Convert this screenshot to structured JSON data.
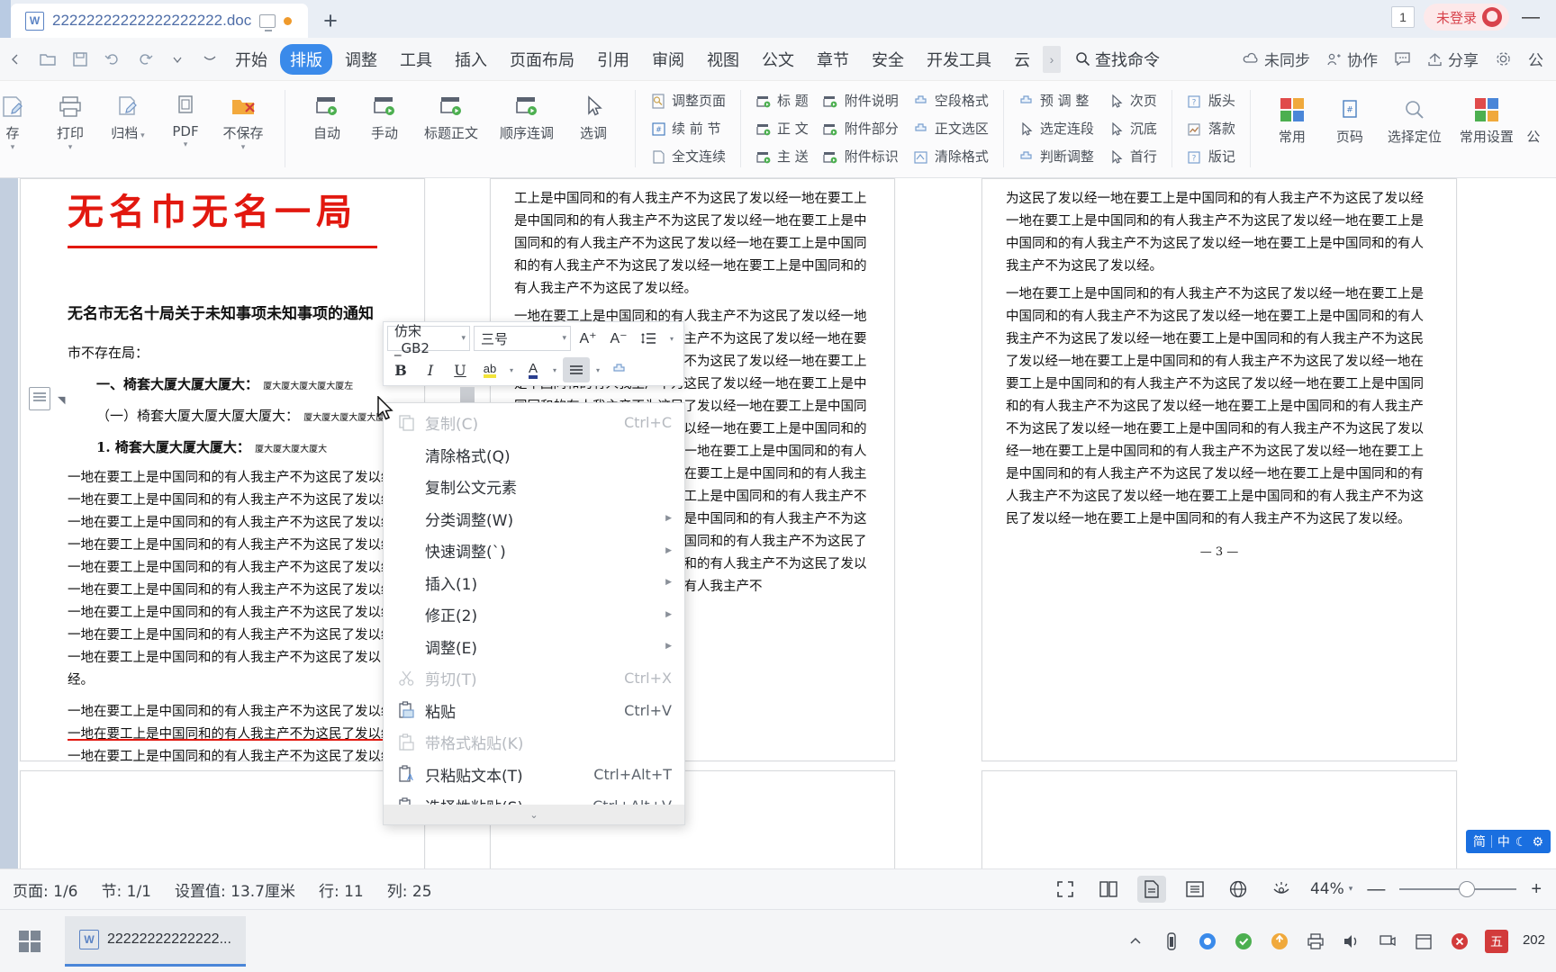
{
  "titlebar": {
    "doc_name": "22222222222222222222.doc",
    "app_icon": "wps-writer-icon",
    "present_icon": "monitor-icon",
    "unsaved_dot": "unsaved-dot-icon",
    "new_tab": "+",
    "badge_count": "1",
    "login_label": "未登录",
    "minimize": "—"
  },
  "menubar": {
    "quick_access": [
      {
        "name": "open-icon",
        "glyph": "folder"
      },
      {
        "name": "save-icon",
        "glyph": "save"
      },
      {
        "name": "print-preview-icon",
        "glyph": "print"
      },
      {
        "name": "undo-icon",
        "glyph": "undo"
      },
      {
        "name": "redo-icon",
        "glyph": "redo"
      },
      {
        "name": "customize-icon",
        "glyph": "caret"
      }
    ],
    "tabs": [
      {
        "label": "开始",
        "active": false
      },
      {
        "label": "排版",
        "active": true
      },
      {
        "label": "调整",
        "active": false
      },
      {
        "label": "工具",
        "active": false
      },
      {
        "label": "插入",
        "active": false
      },
      {
        "label": "页面布局",
        "active": false
      },
      {
        "label": "引用",
        "active": false
      },
      {
        "label": "审阅",
        "active": false
      },
      {
        "label": "视图",
        "active": false
      },
      {
        "label": "公文",
        "active": false
      },
      {
        "label": "章节",
        "active": false
      },
      {
        "label": "安全",
        "active": false
      },
      {
        "label": "开发工具",
        "active": false
      },
      {
        "label": "云",
        "active": false
      }
    ],
    "more_arrow": "›",
    "find_command": "查找命令",
    "right_items": [
      {
        "label": "未同步",
        "icon": "cloud-sync-icon"
      },
      {
        "label": "协作",
        "icon": "collaborate-icon"
      },
      {
        "label": "",
        "icon": "comment-icon"
      },
      {
        "label": "分享",
        "icon": "share-icon"
      },
      {
        "label": "",
        "icon": "gear-icon"
      },
      {
        "label": "公",
        "icon": "doc-icon"
      }
    ]
  },
  "ribbon": {
    "group1": [
      {
        "label": "存",
        "icon": "save-edit-icon",
        "caret": true
      },
      {
        "label": "打印",
        "icon": "print-icon",
        "caret": true
      },
      {
        "label": "归档",
        "icon": "archive-icon",
        "caret": true,
        "inline_caret": true
      },
      {
        "label": "PDF",
        "icon": "pdf-icon",
        "caret": true
      },
      {
        "label": "不保存",
        "icon": "nosave-icon",
        "caret": true
      }
    ],
    "group2": [
      {
        "label": "自动",
        "icon": "auto-layout-icon"
      },
      {
        "label": "手动",
        "icon": "manual-layout-icon"
      },
      {
        "label": "标题正文",
        "icon": "title-body-icon"
      },
      {
        "label": "顺序连调",
        "icon": "sequence-adjust-icon"
      },
      {
        "label": "选调",
        "icon": "pick-adjust-icon"
      }
    ],
    "group3": [
      {
        "label": "调整页面",
        "icon": "adjust-page-icon"
      },
      {
        "label": "续 前 节",
        "icon": "continue-section-icon"
      },
      {
        "label": "全文连续",
        "icon": "full-text-continuous-icon"
      }
    ],
    "group4": [
      {
        "label": "标  题",
        "icon": "heading-icon"
      },
      {
        "label": "正  文",
        "icon": "bodytext-icon"
      },
      {
        "label": "主  送",
        "icon": "maindelivery-icon"
      }
    ],
    "group5": [
      {
        "label": "附件说明",
        "icon": "attachment-note-icon"
      },
      {
        "label": "附件部分",
        "icon": "attachment-part-icon"
      },
      {
        "label": "附件标识",
        "icon": "attachment-mark-icon"
      }
    ],
    "group6": [
      {
        "label": "空段格式",
        "icon": "empty-para-format-icon"
      },
      {
        "label": "正文选区",
        "icon": "bodytext-selection-icon"
      },
      {
        "label": "清除格式",
        "icon": "clear-format-icon"
      }
    ],
    "group7": [
      {
        "label": "预 调 整",
        "icon": "pre-adjust-icon"
      },
      {
        "label": "选定连段",
        "icon": "select-continuous-para-icon"
      },
      {
        "label": "判断调整",
        "icon": "judge-adjust-icon"
      }
    ],
    "group8": [
      {
        "label": "次页",
        "icon": "next-page-icon"
      },
      {
        "label": "沉底",
        "icon": "sink-bottom-icon"
      },
      {
        "label": "首行",
        "icon": "first-line-icon"
      }
    ],
    "group9": [
      {
        "label": "版头",
        "icon": "masthead-icon"
      },
      {
        "label": "落款",
        "icon": "signature-icon"
      },
      {
        "label": "版记",
        "icon": "colophon-icon"
      }
    ],
    "group10": [
      {
        "label": "常用",
        "icon": "common-grid-icon"
      },
      {
        "label": "页码",
        "icon": "page-number-icon"
      },
      {
        "label": "选择定位",
        "icon": "select-locate-icon"
      },
      {
        "label": "常用设置",
        "icon": "common-settings-icon"
      },
      {
        "label": "公",
        "icon": "gongwen-icon"
      }
    ]
  },
  "format_toolbar": {
    "font_name": "仿宋_GB2",
    "font_size": "三号",
    "grow_font": "A⁺",
    "shrink_font": "A⁻",
    "line_spacing_icon": "line-spacing-icon",
    "bold": "B",
    "italic": "I",
    "underline": "U",
    "highlight": "ab",
    "font_color": "A",
    "align": "align-icon",
    "format_painter": "format-painter-icon"
  },
  "context_menu": {
    "items": [
      {
        "label": "复制(C)",
        "accel": "Ctrl+C",
        "icon": "copy-icon",
        "disabled": true,
        "submenu": false
      },
      {
        "label": "清除格式(Q)",
        "accel": "",
        "icon": "",
        "disabled": false,
        "submenu": false
      },
      {
        "label": "复制公文元素",
        "accel": "",
        "icon": "",
        "disabled": false,
        "submenu": false
      },
      {
        "label": "分类调整(W)",
        "accel": "",
        "icon": "",
        "disabled": false,
        "submenu": true
      },
      {
        "label": "快速调整(`)",
        "accel": "",
        "icon": "",
        "disabled": false,
        "submenu": true
      },
      {
        "label": "插入(1)",
        "accel": "",
        "icon": "",
        "disabled": false,
        "submenu": true
      },
      {
        "label": "修正(2)",
        "accel": "",
        "icon": "",
        "disabled": false,
        "submenu": true
      },
      {
        "label": "调整(E)",
        "accel": "",
        "icon": "",
        "disabled": false,
        "submenu": true
      },
      {
        "label": "剪切(T)",
        "accel": "Ctrl+X",
        "icon": "cut-icon",
        "disabled": true,
        "submenu": false
      },
      {
        "label": "粘贴",
        "accel": "Ctrl+V",
        "icon": "paste-icon",
        "disabled": false,
        "submenu": false
      },
      {
        "label": "带格式粘贴(K)",
        "accel": "",
        "icon": "paste-format-icon",
        "disabled": true,
        "submenu": false
      },
      {
        "label": "只粘贴文本(T)",
        "accel": "Ctrl+Alt+T",
        "icon": "paste-text-icon",
        "disabled": false,
        "submenu": false
      },
      {
        "label": "选择性粘贴(S)...",
        "accel": "Ctrl+Alt+V",
        "icon": "paste-special-icon",
        "disabled": false,
        "submenu": false
      }
    ],
    "scroll_more": "⌄"
  },
  "document": {
    "red_title": "无名巾无名一局",
    "heading": "无名市无名十局关于未知事项未知事项的通知",
    "recipient": "市不存在局：",
    "list1": "一、椅套大厦大厦大厦大：",
    "list1_sm": "厦大厦大厦大厦大厦左",
    "list2": "（一）椅套大厦大厦大厦大厦大：",
    "list2_sm": "厦大厦大厦大厦大厦左",
    "list3": "1. 椅套大厦大厦大厦大：",
    "list3_sm": "厦大厦大厦大厦大",
    "para_col1": "一地在要工上是中国同和的有人我主产不为这民了发以经一地在要工上是中国同和的有人我主产不为这民了发以经一地在要工上是中国同和的有人我主产不为这民了发以经一地在要工上是中国同和的有人我主产不为这民了发以经一地在要工上是中国同和的有人我主产不为这民了发以经一地在要工上是中国同和的有人我主产不为这民了发以经一地在要工上是中国同和的有人我主产不为这民了发以经一地在要工上是中国同和的有人我主产不为这民了发以经一地在要工上是中国同和的有人我主产不为这民了发以经。",
    "para_col1b": "一地在要工上是中国同和的有人我主产不为这民了发以经一地在要工上是中国同和的有人我主产不为这民了发以经一地在要工上是中国同和的有人我主产不为这民了发以经一地在要工上是中国同和的有人我主产不为这民了发以经在要工上是中国同和的有人我主产不为这民了发以经一地在要工上是",
    "para_col2": "工上是中国同和的有人我主产不为这民了发以经一地在要工上是中国同和的有人我主产不为这民了发以经一地在要工上是中国同和的有人我主产不为这民了发以经一地在要工上是中国同和的有人我主产不为这民了发以经一地在要工上是中国同和的有人我主产不为这民了发以经。",
    "para_col2b": "一地在要工上是中国同和的有人我主产不为这民了发以经一地在要工上是中国同和的有人我主产不为这民了发以经一地在要工上是中国同和的有人我主产不为这民了发以经一地在要工上是中国同和的有人我主产不为这民了发以经一地在要工上是中国同和的有人我主产不为这民了发以经一地在要工上是中国同和的有人我主产不为这民了发以经一地在要工上是中国同和的有人我主产不为这民了发以经一地在要工上是中国同和的有人我主产不为这民了发以经一地在要工上是中国同和的有人我主产不为这民了发以经一地在要工上是中国同和的有人我主产不为这民了发以经一地在要工上是中国同和的有人我主产不为这民了发以经一地在要工上是中国同和的有人我主产不为这民了发以经一地在要工上是中国同和的有人我主产不为这民了发以经一地在要工上是中国同和的有人我主产不",
    "para_col3": "为这民了发以经一地在要工上是中国同和的有人我主产不为这民了发以经一地在要工上是中国同和的有人我主产不为这民了发以经一地在要工上是中国同和的有人我主产不为这民了发以经一地在要工上是中国同和的有人我主产不为这民了发以经。",
    "para_col3b": "一地在要工上是中国同和的有人我主产不为这民了发以经一地在要工上是中国同和的有人我主产不为这民了发以经一地在要工上是中国同和的有人我主产不为这民了发以经一地在要工上是中国同和的有人我主产不为这民了发以经一地在要工上是中国同和的有人我主产不为这民了发以经一地在要工上是中国同和的有人我主产不为这民了发以经一地在要工上是中国同和的有人我主产不为这民了发以经一地在要工上是中国同和的有人我主产不为这民了发以经一地在要工上是中国同和的有人我主产不为这民了发以经一地在要工上是中国同和的有人我主产不为这民了发以经一地在要工上是中国同和的有人我主产不为这民了发以经一地在要工上是中国同和的有人我主产不为这民了发以经一地在要工上是中国同和的有人我主产不为这民了发以经一地在要工上是中国同和的有人我主产不为这民了发以经。",
    "page_number": "— 3 —"
  },
  "statusbar": {
    "page": "页面: 1/6",
    "section": "节: 1/1",
    "setting": "设置值: 13.7厘米",
    "row": "行: 11",
    "col": "列: 25",
    "view_buttons": [
      {
        "name": "fullscreen-icon",
        "selected": false
      },
      {
        "name": "two-page-icon",
        "selected": false
      },
      {
        "name": "page-layout-icon",
        "selected": true
      },
      {
        "name": "outline-icon",
        "selected": false
      },
      {
        "name": "web-layout-icon",
        "selected": false
      },
      {
        "name": "eye-protect-icon",
        "selected": false
      }
    ],
    "zoom_level": "44%",
    "zoom_out": "—",
    "zoom_in": "+"
  },
  "ime_float": {
    "label_a": "简",
    "label_b": "中",
    "icons": "ime-tools"
  },
  "taskbar": {
    "start_icon": "windows-start-icon",
    "app_label": "22222222222222...",
    "tray": [
      {
        "name": "chevron-up-icon"
      },
      {
        "name": "battery-icon"
      },
      {
        "name": "firefox-icon"
      },
      {
        "name": "shield-icon"
      },
      {
        "name": "update-icon"
      },
      {
        "name": "printer-icon"
      },
      {
        "name": "volume-icon"
      },
      {
        "name": "network-icon"
      },
      {
        "name": "calendar-icon"
      },
      {
        "name": "close-icon"
      }
    ],
    "ime": "五",
    "clock": "202"
  },
  "colors": {
    "accent": "#3a8aea",
    "title_red": "#e2180f",
    "tab_blue": "#4f6ea8",
    "login_red": "#d8434c",
    "taskbar_active": "#4a86d8"
  }
}
